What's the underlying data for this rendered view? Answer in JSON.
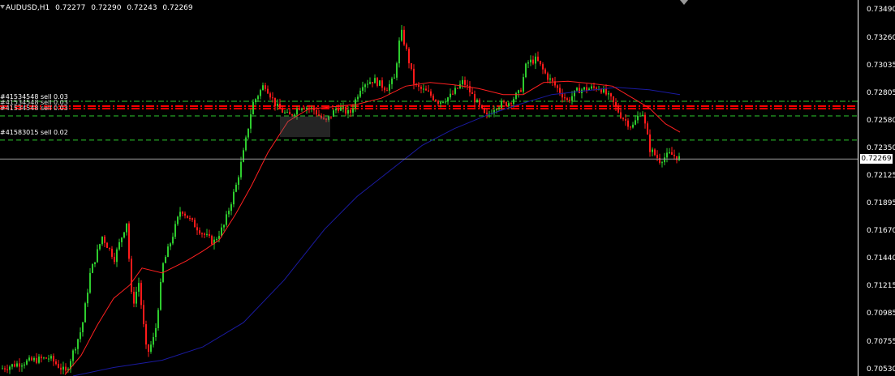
{
  "window": {
    "symbol_period": "AUDUSD,H1",
    "ohlc": [
      "0.72277",
      "0.72290",
      "0.72243",
      "0.72269"
    ]
  },
  "price_axis": {
    "ticks": [
      "0.73490",
      "0.73260",
      "0.73035",
      "0.72805",
      "0.72580",
      "0.72350",
      "0.72125",
      "0.71895",
      "0.71670",
      "0.71440",
      "0.71215",
      "0.70985",
      "0.70755",
      "0.70530"
    ],
    "bid_label": "0.72269"
  },
  "order_labels": [
    "#41534548 sell 0.03",
    "#41583015 sell 0.02"
  ],
  "colors": {
    "background": "#000000",
    "bull_candle": "#2ecc2e",
    "bear_candle": "#ff1a1a",
    "fast_ma": "#ff2020",
    "slow_ma": "#1a1aa0",
    "order_line": "#2ecc2e",
    "stop_line": "#ff0000"
  },
  "icons": {
    "menu": "triangle-down-icon",
    "scroll": "shift-marker-icon"
  },
  "chart_data": {
    "type": "candlestick",
    "ylim": [
      0.7048,
      0.7358
    ],
    "current_price": 0.72269,
    "order_levels": [
      0.72745,
      0.72625,
      0.72425
    ],
    "stop_levels": [
      0.72705,
      0.72685
    ],
    "waypoints": [
      [
        0,
        0.7054
      ],
      [
        20,
        0.7058
      ],
      [
        40,
        0.7061
      ],
      [
        60,
        0.7063
      ],
      [
        80,
        0.7051
      ],
      [
        100,
        0.7088
      ],
      [
        110,
        0.7132
      ],
      [
        125,
        0.7163
      ],
      [
        140,
        0.7145
      ],
      [
        155,
        0.7175
      ],
      [
        162,
        0.7105
      ],
      [
        170,
        0.7125
      ],
      [
        180,
        0.7065
      ],
      [
        190,
        0.7082
      ],
      [
        200,
        0.714
      ],
      [
        210,
        0.716
      ],
      [
        222,
        0.7186
      ],
      [
        235,
        0.7175
      ],
      [
        250,
        0.7165
      ],
      [
        262,
        0.7158
      ],
      [
        275,
        0.7172
      ],
      [
        290,
        0.7205
      ],
      [
        300,
        0.7235
      ],
      [
        310,
        0.7272
      ],
      [
        325,
        0.7289
      ],
      [
        340,
        0.727
      ],
      [
        355,
        0.7262
      ],
      [
        370,
        0.7271
      ],
      [
        385,
        0.7268
      ],
      [
        400,
        0.7257
      ],
      [
        415,
        0.727
      ],
      [
        430,
        0.7264
      ],
      [
        445,
        0.7289
      ],
      [
        460,
        0.7292
      ],
      [
        475,
        0.7285
      ],
      [
        485,
        0.7293
      ],
      [
        493,
        0.7333
      ],
      [
        500,
        0.7316
      ],
      [
        510,
        0.7287
      ],
      [
        525,
        0.7282
      ],
      [
        540,
        0.7274
      ],
      [
        555,
        0.7279
      ],
      [
        570,
        0.7291
      ],
      [
        585,
        0.7275
      ],
      [
        598,
        0.7261
      ],
      [
        610,
        0.7271
      ],
      [
        625,
        0.7273
      ],
      [
        640,
        0.7282
      ],
      [
        648,
        0.7306
      ],
      [
        660,
        0.7309
      ],
      [
        672,
        0.7296
      ],
      [
        685,
        0.7286
      ],
      [
        698,
        0.7275
      ],
      [
        712,
        0.7284
      ],
      [
        725,
        0.7285
      ],
      [
        738,
        0.7286
      ],
      [
        752,
        0.7276
      ],
      [
        765,
        0.7262
      ],
      [
        778,
        0.7253
      ],
      [
        790,
        0.7268
      ],
      [
        800,
        0.7235
      ],
      [
        812,
        0.7226
      ],
      [
        825,
        0.7231
      ],
      [
        838,
        0.7227
      ]
    ],
    "fast_ma_points": [
      [
        80,
        0.7049
      ],
      [
        100,
        0.7065
      ],
      [
        120,
        0.709
      ],
      [
        140,
        0.7112
      ],
      [
        160,
        0.7123
      ],
      [
        175,
        0.7137
      ],
      [
        200,
        0.7133
      ],
      [
        230,
        0.7143
      ],
      [
        250,
        0.7151
      ],
      [
        270,
        0.716
      ],
      [
        290,
        0.7181
      ],
      [
        310,
        0.7205
      ],
      [
        330,
        0.7232
      ],
      [
        355,
        0.7258
      ],
      [
        380,
        0.7268
      ],
      [
        410,
        0.727
      ],
      [
        440,
        0.7272
      ],
      [
        470,
        0.7277
      ],
      [
        500,
        0.7287
      ],
      [
        530,
        0.729
      ],
      [
        560,
        0.7288
      ],
      [
        590,
        0.7285
      ],
      [
        620,
        0.728
      ],
      [
        645,
        0.728
      ],
      [
        670,
        0.729
      ],
      [
        700,
        0.7291
      ],
      [
        730,
        0.7289
      ],
      [
        755,
        0.7287
      ],
      [
        780,
        0.7277
      ],
      [
        800,
        0.7269
      ],
      [
        820,
        0.7256
      ],
      [
        838,
        0.7249
      ]
    ],
    "slow_ma_points": [
      [
        90,
        0.7048
      ],
      [
        140,
        0.7055
      ],
      [
        200,
        0.7061
      ],
      [
        250,
        0.7072
      ],
      [
        300,
        0.7092
      ],
      [
        350,
        0.7127
      ],
      [
        400,
        0.7169
      ],
      [
        440,
        0.7196
      ],
      [
        480,
        0.7217
      ],
      [
        520,
        0.7238
      ],
      [
        560,
        0.7252
      ],
      [
        600,
        0.7263
      ],
      [
        640,
        0.7272
      ],
      [
        680,
        0.728
      ],
      [
        720,
        0.7283
      ],
      [
        760,
        0.7286
      ],
      [
        800,
        0.7284
      ],
      [
        838,
        0.728
      ]
    ]
  }
}
